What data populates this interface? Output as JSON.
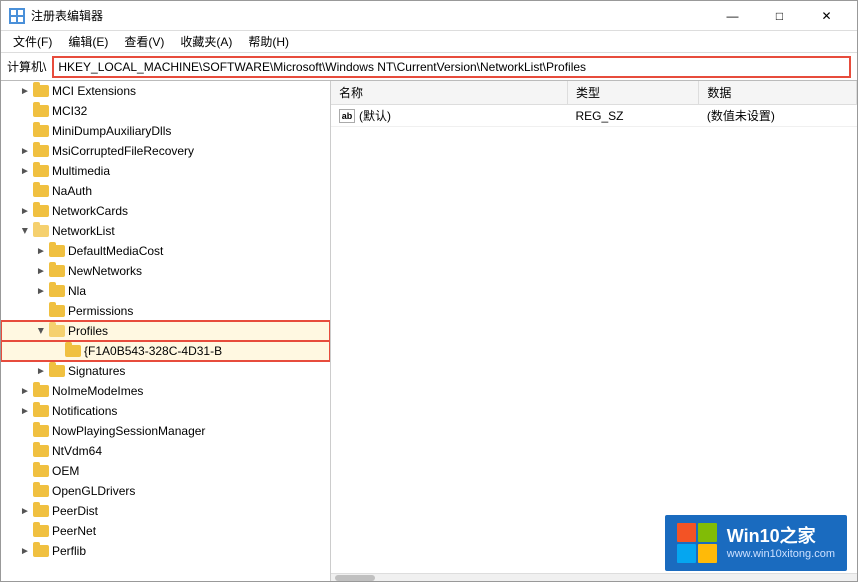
{
  "window": {
    "title": "注册表编辑器",
    "icon": "regedit"
  },
  "titlebar": {
    "controls": [
      "minimize",
      "maximize",
      "close"
    ]
  },
  "menubar": {
    "items": [
      "文件(F)",
      "编辑(E)",
      "查看(V)",
      "收藏夹(A)",
      "帮助(H)"
    ]
  },
  "addressbar": {
    "label": "计算机\\",
    "value": "HKEY_LOCAL_MACHINE\\SOFTWARE\\Microsoft\\Windows NT\\CurrentVersion\\NetworkList\\Profiles"
  },
  "tree": {
    "items": [
      {
        "id": "mci",
        "label": "MCI Extensions",
        "level": 1,
        "type": "folder-closed",
        "expanded": false
      },
      {
        "id": "mci32",
        "label": "MCI32",
        "level": 1,
        "type": "folder-closed",
        "expanded": false
      },
      {
        "id": "minidump",
        "label": "MiniDumpAuxiliaryDlls",
        "level": 1,
        "type": "folder-closed",
        "expanded": false
      },
      {
        "id": "msicorrupted",
        "label": "MsiCorruptedFileRecovery",
        "level": 1,
        "type": "folder-closed",
        "expanded": false
      },
      {
        "id": "multimedia",
        "label": "Multimedia",
        "level": 1,
        "type": "folder-closed",
        "expanded": false
      },
      {
        "id": "naauth",
        "label": "NaAuth",
        "level": 1,
        "type": "folder-closed",
        "expanded": false
      },
      {
        "id": "networkcards",
        "label": "NetworkCards",
        "level": 1,
        "type": "folder-closed",
        "expanded": false
      },
      {
        "id": "networklist",
        "label": "NetworkList",
        "level": 1,
        "type": "folder-open",
        "expanded": true
      },
      {
        "id": "defaultmediacost",
        "label": "DefaultMediaCost",
        "level": 2,
        "type": "folder-closed",
        "expanded": false
      },
      {
        "id": "newnetworks",
        "label": "NewNetworks",
        "level": 2,
        "type": "folder-closed",
        "expanded": false
      },
      {
        "id": "nla",
        "label": "Nla",
        "level": 2,
        "type": "folder-closed",
        "expanded": false
      },
      {
        "id": "permissions",
        "label": "Permissions",
        "level": 2,
        "type": "folder-closed",
        "expanded": false
      },
      {
        "id": "profiles",
        "label": "Profiles",
        "level": 2,
        "type": "folder-open",
        "expanded": true,
        "highlight": true
      },
      {
        "id": "profile-guid",
        "label": "{F1A0B543-328C-4D31-B",
        "level": 3,
        "type": "folder-closed",
        "expanded": false,
        "highlight": true
      },
      {
        "id": "signatures",
        "label": "Signatures",
        "level": 2,
        "type": "folder-closed",
        "expanded": false
      },
      {
        "id": "noimemodelmes",
        "label": "NoImeModeImes",
        "level": 1,
        "type": "folder-closed",
        "expanded": false
      },
      {
        "id": "notifications",
        "label": "Notifications",
        "level": 1,
        "type": "folder-closed",
        "expanded": false
      },
      {
        "id": "nowplaying",
        "label": "NowPlayingSessionManager",
        "level": 1,
        "type": "folder-closed",
        "expanded": false
      },
      {
        "id": "ntvdm64",
        "label": "NtVdm64",
        "level": 1,
        "type": "folder-closed",
        "expanded": false
      },
      {
        "id": "oem",
        "label": "OEM",
        "level": 1,
        "type": "folder-closed",
        "expanded": false
      },
      {
        "id": "opengldrivers",
        "label": "OpenGLDrivers",
        "level": 1,
        "type": "folder-closed",
        "expanded": false
      },
      {
        "id": "peerdist",
        "label": "PeerDist",
        "level": 1,
        "type": "folder-closed",
        "expanded": false
      },
      {
        "id": "peernet",
        "label": "PeerNet",
        "level": 1,
        "type": "folder-closed",
        "expanded": false
      },
      {
        "id": "perflib",
        "label": "Perflib",
        "level": 1,
        "type": "folder-closed",
        "expanded": false
      }
    ]
  },
  "registry_table": {
    "columns": [
      "名称",
      "类型",
      "数据"
    ],
    "rows": [
      {
        "name": "(默认)",
        "type": "REG_SZ",
        "data": "(数值未设置)",
        "icon": "ab"
      }
    ]
  },
  "watermark": {
    "title": "Win10之家",
    "url": "www.win10xitong.com"
  }
}
